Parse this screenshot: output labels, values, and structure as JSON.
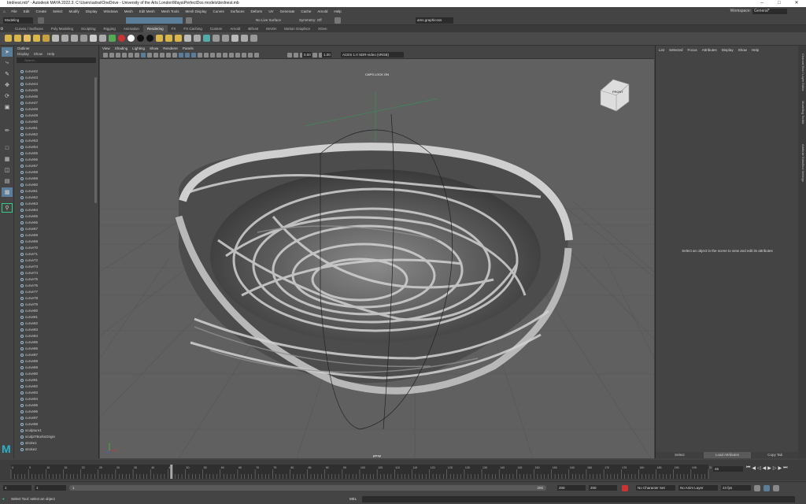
{
  "window": {
    "title": "birdnest.mb* - Autodesk MAYA 2022.3: C:\\Users\\adrai\\OneDrive - University of the Arts London\\Maya\\PerfectDos models\\birdnest.mb"
  },
  "menubar": {
    "items": [
      "File",
      "Edit",
      "Create",
      "Select",
      "Modify",
      "Display",
      "Windows",
      "Mesh",
      "Edit Mesh",
      "Mesh Tools",
      "Mesh Display",
      "Curves",
      "Surfaces",
      "Deform",
      "UV",
      "Generate",
      "Cache",
      "Arnold",
      "Help"
    ],
    "workspace_label": "Workspace:",
    "workspace_value": "General*"
  },
  "statusline": {
    "mode": "Modeling",
    "live_surface": "No Live Surface",
    "symmetry": "Symmetry: Off",
    "signin": "ams.graphicsss"
  },
  "shelf": {
    "tabs": [
      "Curves / Surfaces",
      "Poly Modeling",
      "Sculpting",
      "Rigging",
      "Animation",
      "Rendering",
      "FX",
      "FX Caching",
      "Custom",
      "Arnold",
      "Bifrost",
      "MASH",
      "Motion Graphics",
      "XGen"
    ],
    "active_tab": "Rendering"
  },
  "outliner": {
    "title": "Outliner",
    "menu": [
      "Display",
      "Show",
      "Help"
    ],
    "search_placeholder": "Search...",
    "items": [
      "curve42",
      "curve43",
      "curve44",
      "curve45",
      "curve46",
      "curve47",
      "curve48",
      "curve49",
      "curve50",
      "curve51",
      "curve52",
      "curve53",
      "curve54",
      "curve55",
      "curve56",
      "curve57",
      "curve58",
      "curve59",
      "curve60",
      "curve61",
      "curve62",
      "curve63",
      "curve64",
      "curve65",
      "curve66",
      "curve67",
      "curve68",
      "curve69",
      "curve70",
      "curve71",
      "curve72",
      "curve73",
      "curve74",
      "curve75",
      "curve76",
      "curve77",
      "curve78",
      "curve79",
      "curve80",
      "curve81",
      "curve82",
      "curve83",
      "curve84",
      "curve85",
      "curve86",
      "curve87",
      "curve88",
      "curve89",
      "curve90",
      "curve91",
      "curve92",
      "curve93",
      "curve94",
      "curve95",
      "curve96",
      "curve97",
      "curve98",
      "sculpture1",
      "sculptTBorksOrigin",
      "stroke1",
      "stroke2"
    ]
  },
  "viewport": {
    "menu": [
      "View",
      "Shading",
      "Lighting",
      "Show",
      "Renderer",
      "Panels"
    ],
    "caps_lock": "CAPS LOCK ON",
    "camera": "persp",
    "exposure": "0.00",
    "gamma": "1.00",
    "colorspace": "ACES 1.0 SDR-video (sRGB)",
    "viewcube_label": "FRONT"
  },
  "attribute_editor": {
    "menu": [
      "List",
      "Selected",
      "Focus",
      "Attributes",
      "Display",
      "Show",
      "Help"
    ],
    "message": "Select an object in the scene to view and edit its attributes",
    "buttons": [
      "Select",
      "Load Attributes",
      "Copy Tab"
    ]
  },
  "sidetabs": [
    "Channel Box / Layer Editor",
    "Modelling Toolkit",
    "Attribute Editor",
    "Tool Settings"
  ],
  "timeline": {
    "ticks": [
      "0",
      "5",
      "10",
      "15",
      "20",
      "25",
      "30",
      "35",
      "40",
      "45",
      "50",
      "55",
      "60",
      "65",
      "70",
      "75",
      "80",
      "85",
      "90",
      "95",
      "100",
      "105",
      "110",
      "115",
      "120",
      "125",
      "130",
      "135",
      "140",
      "145",
      "150",
      "155",
      "160",
      "165",
      "170",
      "175",
      "180",
      "185",
      "190",
      "195",
      "200"
    ],
    "current_frame": "46",
    "current_frame_right": "46"
  },
  "rangebar": {
    "start": "1",
    "inner_start": "1",
    "inner_end": "200",
    "end_a": "200",
    "end_b": "200",
    "character_set": "No Character Set",
    "anim_layer": "No Anim Layer",
    "fps": "24 fps"
  },
  "helpline": {
    "text": "Select Tool: select an object",
    "mel": "MEL"
  },
  "colors": {
    "accent_blue": "#5a7d9a",
    "maya_logo": "#2bb1c9",
    "grid": "#555555"
  }
}
